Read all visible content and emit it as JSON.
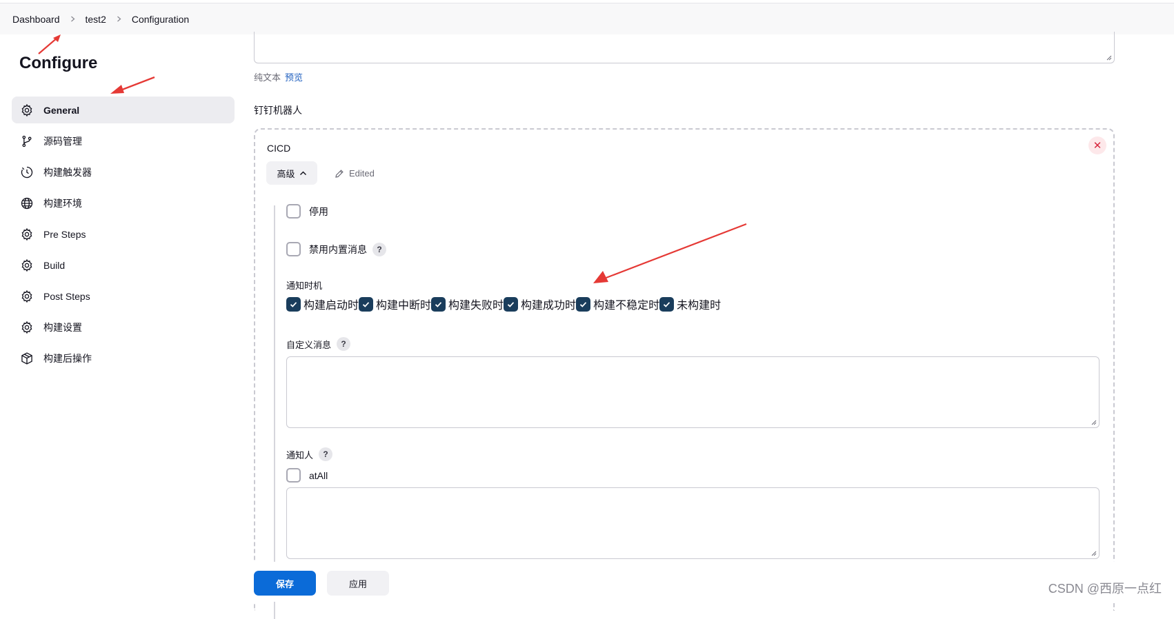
{
  "breadcrumb": [
    "Dashboard",
    "test2",
    "Configuration"
  ],
  "page": {
    "title": "Configure"
  },
  "sidebar": {
    "items": [
      {
        "label": "General",
        "icon": "gear-icon",
        "active": true
      },
      {
        "label": "源码管理",
        "icon": "branch-icon"
      },
      {
        "label": "构建触发器",
        "icon": "timer-icon"
      },
      {
        "label": "构建环境",
        "icon": "globe-icon"
      },
      {
        "label": "Pre Steps",
        "icon": "gear-icon"
      },
      {
        "label": "Build",
        "icon": "gear-icon"
      },
      {
        "label": "Post Steps",
        "icon": "gear-icon"
      },
      {
        "label": "构建设置",
        "icon": "gear-icon"
      },
      {
        "label": "构建后操作",
        "icon": "package-icon"
      }
    ]
  },
  "main": {
    "format_plain": "纯文本",
    "format_preview": "预览",
    "section_label": "钉钉机器人",
    "robot": {
      "name": "CICD",
      "advanced_label": "高级",
      "edited_label": "Edited",
      "disable_label": "停用",
      "disable_builtin_label": "禁用内置消息",
      "timing_label": "通知时机",
      "timings": [
        {
          "label": "构建启动时",
          "checked": true
        },
        {
          "label": "构建中断时",
          "checked": true
        },
        {
          "label": "构建失败时",
          "checked": true
        },
        {
          "label": "构建成功时",
          "checked": true
        },
        {
          "label": "构建不稳定时",
          "checked": true
        },
        {
          "label": "未构建时",
          "checked": true
        }
      ],
      "custom_message_label": "自定义消息",
      "custom_message_value": "",
      "notify_label": "通知人",
      "at_all_label": "atAll",
      "notify_value": ""
    }
  },
  "footer": {
    "save_label": "保存",
    "apply_label": "应用"
  },
  "watermark": "CSDN @西原一点红",
  "colors": {
    "primary": "#0b6bd8",
    "checked": "#1a3d5c",
    "annotation_arrow": "#e53935",
    "danger": "#d7263d"
  }
}
